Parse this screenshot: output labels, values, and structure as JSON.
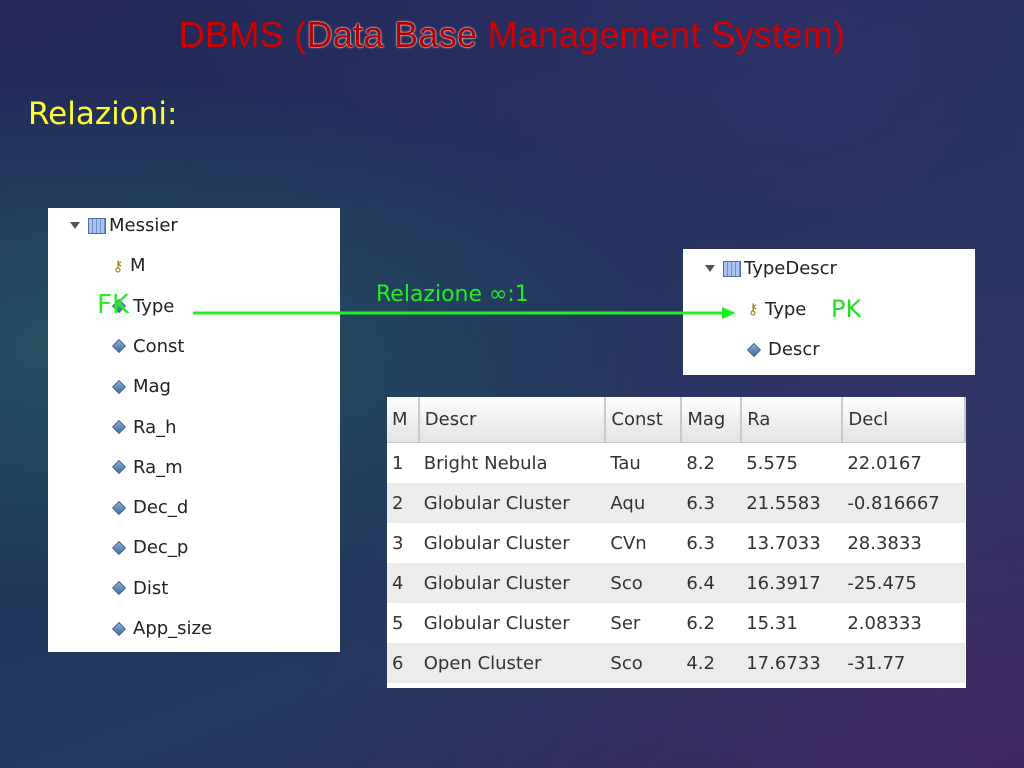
{
  "slide": {
    "title_pre": "DBMS (",
    "title_highlight": "Data Base",
    "title_post": " Management System)",
    "subtitle": "Relazioni:"
  },
  "messier_tree": {
    "table_name": "Messier",
    "fields": [
      {
        "name": "M",
        "icon": "key-icon"
      },
      {
        "name": "Type",
        "icon": "diamond-icon"
      },
      {
        "name": "Const",
        "icon": "diamond-icon"
      },
      {
        "name": "Mag",
        "icon": "diamond-icon"
      },
      {
        "name": "Ra_h",
        "icon": "diamond-icon"
      },
      {
        "name": "Ra_m",
        "icon": "diamond-icon"
      },
      {
        "name": "Dec_d",
        "icon": "diamond-icon"
      },
      {
        "name": "Dec_p",
        "icon": "diamond-icon"
      },
      {
        "name": "Dist",
        "icon": "diamond-icon"
      },
      {
        "name": "App_size",
        "icon": "diamond-icon"
      }
    ]
  },
  "typedescr_tree": {
    "table_name": "TypeDescr",
    "fields": [
      {
        "name": "Type",
        "icon": "key-icon"
      },
      {
        "name": "Descr",
        "icon": "diamond-icon"
      }
    ]
  },
  "annotations": {
    "fk": "FK",
    "pk": "PK",
    "relation": "Relazione ∞:1",
    "color": "#22ee22"
  },
  "result_table": {
    "columns": [
      "M",
      "Descr",
      "Const",
      "Mag",
      "Ra",
      "Decl"
    ],
    "rows": [
      [
        "1",
        "Bright Nebula",
        "Tau",
        "8.2",
        "5.575",
        "22.0167"
      ],
      [
        "2",
        "Globular Cluster",
        "Aqu",
        "6.3",
        "21.5583",
        "-0.816667"
      ],
      [
        "3",
        "Globular Cluster",
        "CVn",
        "6.3",
        "13.7033",
        "28.3833"
      ],
      [
        "4",
        "Globular Cluster",
        "Sco",
        "6.4",
        "16.3917",
        "-25.475"
      ],
      [
        "5",
        "Globular Cluster",
        "Ser",
        "6.2",
        "15.31",
        "2.08333"
      ],
      [
        "6",
        "Open Cluster",
        "Sco",
        "4.2",
        "17.6733",
        "-31.77"
      ]
    ]
  }
}
